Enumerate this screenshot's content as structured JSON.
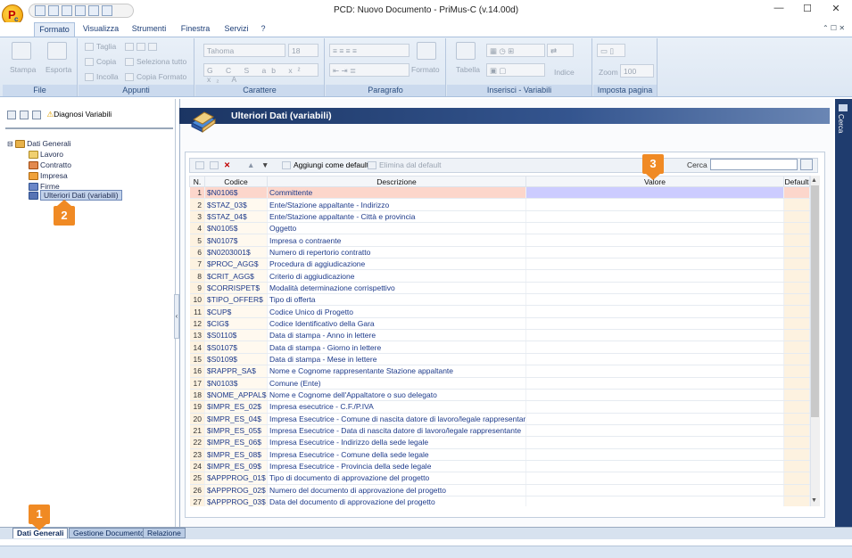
{
  "window": {
    "title": "PCD: Nuovo Documento - PriMus-C  (v.14.00d)",
    "logo_letter": "P",
    "logo_sub": "c"
  },
  "ribbon": {
    "tabs": [
      "Formato",
      "Visualizza",
      "Strumenti",
      "Finestra",
      "Servizi",
      "?"
    ],
    "groups": {
      "file": {
        "title": "File",
        "stampa": "Stampa",
        "esporta": "Esporta"
      },
      "appunti": {
        "title": "Appunti",
        "taglia": "Taglia",
        "copia": "Copia",
        "incolla": "Incolla",
        "seleziona_tutto": "Seleziona tutto",
        "copia_formato": "Copia Formato"
      },
      "carattere": {
        "title": "Carattere",
        "font": "Tahoma",
        "size": "18"
      },
      "paragrafo": {
        "title": "Paragrafo",
        "formato": "Formato"
      },
      "inserisci": {
        "title": "Inserisci - Variabili",
        "tabella": "Tabella",
        "indice": "Indice"
      },
      "pagina": {
        "title": "Imposta pagina",
        "zoom_label": "Zoom",
        "zoom_value": "100"
      }
    }
  },
  "left": {
    "toolbar_label": "Diagnosi Variabili",
    "tree": {
      "root": "Dati Generali",
      "children": [
        "Lavoro",
        "Contratto",
        "Impresa",
        "Firme",
        "Ulteriori Dati (variabili)"
      ]
    }
  },
  "main": {
    "title": "Ulteriori Dati (variabili)",
    "toolbar": {
      "aggiungi": "Aggiungi come default",
      "elimina": "Elimina dal default",
      "cerca": "Cerca",
      "cerca_value": ""
    },
    "columns": [
      "N.",
      "Codice",
      "Descrizione",
      "Valore",
      "Default"
    ],
    "rows": [
      [
        "1",
        "$N0106$",
        "Committente"
      ],
      [
        "2",
        "$STAZ_03$",
        "Ente/Stazione appaltante - Indirizzo"
      ],
      [
        "3",
        "$STAZ_04$",
        "Ente/Stazione appaltante - Città e provincia"
      ],
      [
        "4",
        "$N0105$",
        "Oggetto"
      ],
      [
        "5",
        "$N0107$",
        "Impresa o contraente"
      ],
      [
        "6",
        "$N0203001$",
        "Numero di repertorio contratto"
      ],
      [
        "7",
        "$PROC_AGG$",
        "Procedura di aggiudicazione"
      ],
      [
        "8",
        "$CRIT_AGG$",
        "Criterio di aggiudicazione"
      ],
      [
        "9",
        "$CORRISPET$",
        "Modalità determinazione corrispettivo"
      ],
      [
        "10",
        "$TIPO_OFFER$",
        "Tipo di offerta"
      ],
      [
        "11",
        "$CUP$",
        "Codice Unico di Progetto"
      ],
      [
        "12",
        "$CIG$",
        "Codice Identificativo della Gara"
      ],
      [
        "13",
        "$S0110$",
        "Data di stampa - Anno in lettere"
      ],
      [
        "14",
        "$S0107$",
        "Data di stampa - Giorno in lettere"
      ],
      [
        "15",
        "$S0109$",
        "Data di stampa - Mese in lettere"
      ],
      [
        "16",
        "$RAPPR_SA$",
        "Nome e Cognome rappresentante Stazione appaltante"
      ],
      [
        "17",
        "$N0103$",
        "Comune (Ente)"
      ],
      [
        "18",
        "$NOME_APPAL$",
        "Nome e Cognome dell'Appaltatore o suo delegato"
      ],
      [
        "19",
        "$IMPR_ES_02$",
        "Impresa esecutrice - C.F./P.IVA"
      ],
      [
        "20",
        "$IMPR_ES_04$",
        "Impresa Esecutrice - Comune di nascita datore di lavoro/legale rappresentante"
      ],
      [
        "21",
        "$IMPR_ES_05$",
        "Impresa Esecutrice - Data di nascita datore di lavoro/legale rappresentante"
      ],
      [
        "22",
        "$IMPR_ES_06$",
        "Impresa Esecutrice - Indirizzo della sede legale"
      ],
      [
        "23",
        "$IMPR_ES_08$",
        "Impresa Esecutrice - Comune della sede legale"
      ],
      [
        "24",
        "$IMPR_ES_09$",
        "Impresa Esecutrice - Provincia della sede legale"
      ],
      [
        "25",
        "$APPPROG_01$",
        "Tipo di documento di approvazione del progetto"
      ],
      [
        "26",
        "$APPPROG_02$",
        "Numero del documento di approvazione del progetto"
      ],
      [
        "27",
        "$APPPROG_03$",
        "Data del documento di approvazione del progetto"
      ]
    ]
  },
  "bottom_tabs": [
    "Dati Generali",
    "Gestione Documento",
    "Relazione"
  ],
  "right_panel": {
    "label": "Cerca"
  },
  "badges": {
    "b1": "1",
    "b2": "2",
    "b3": "3"
  },
  "colors": {
    "accent": "#f08a24",
    "header": "#1b3563",
    "selected_row": "#fcd6cb",
    "selected_value": "#ccccff"
  }
}
